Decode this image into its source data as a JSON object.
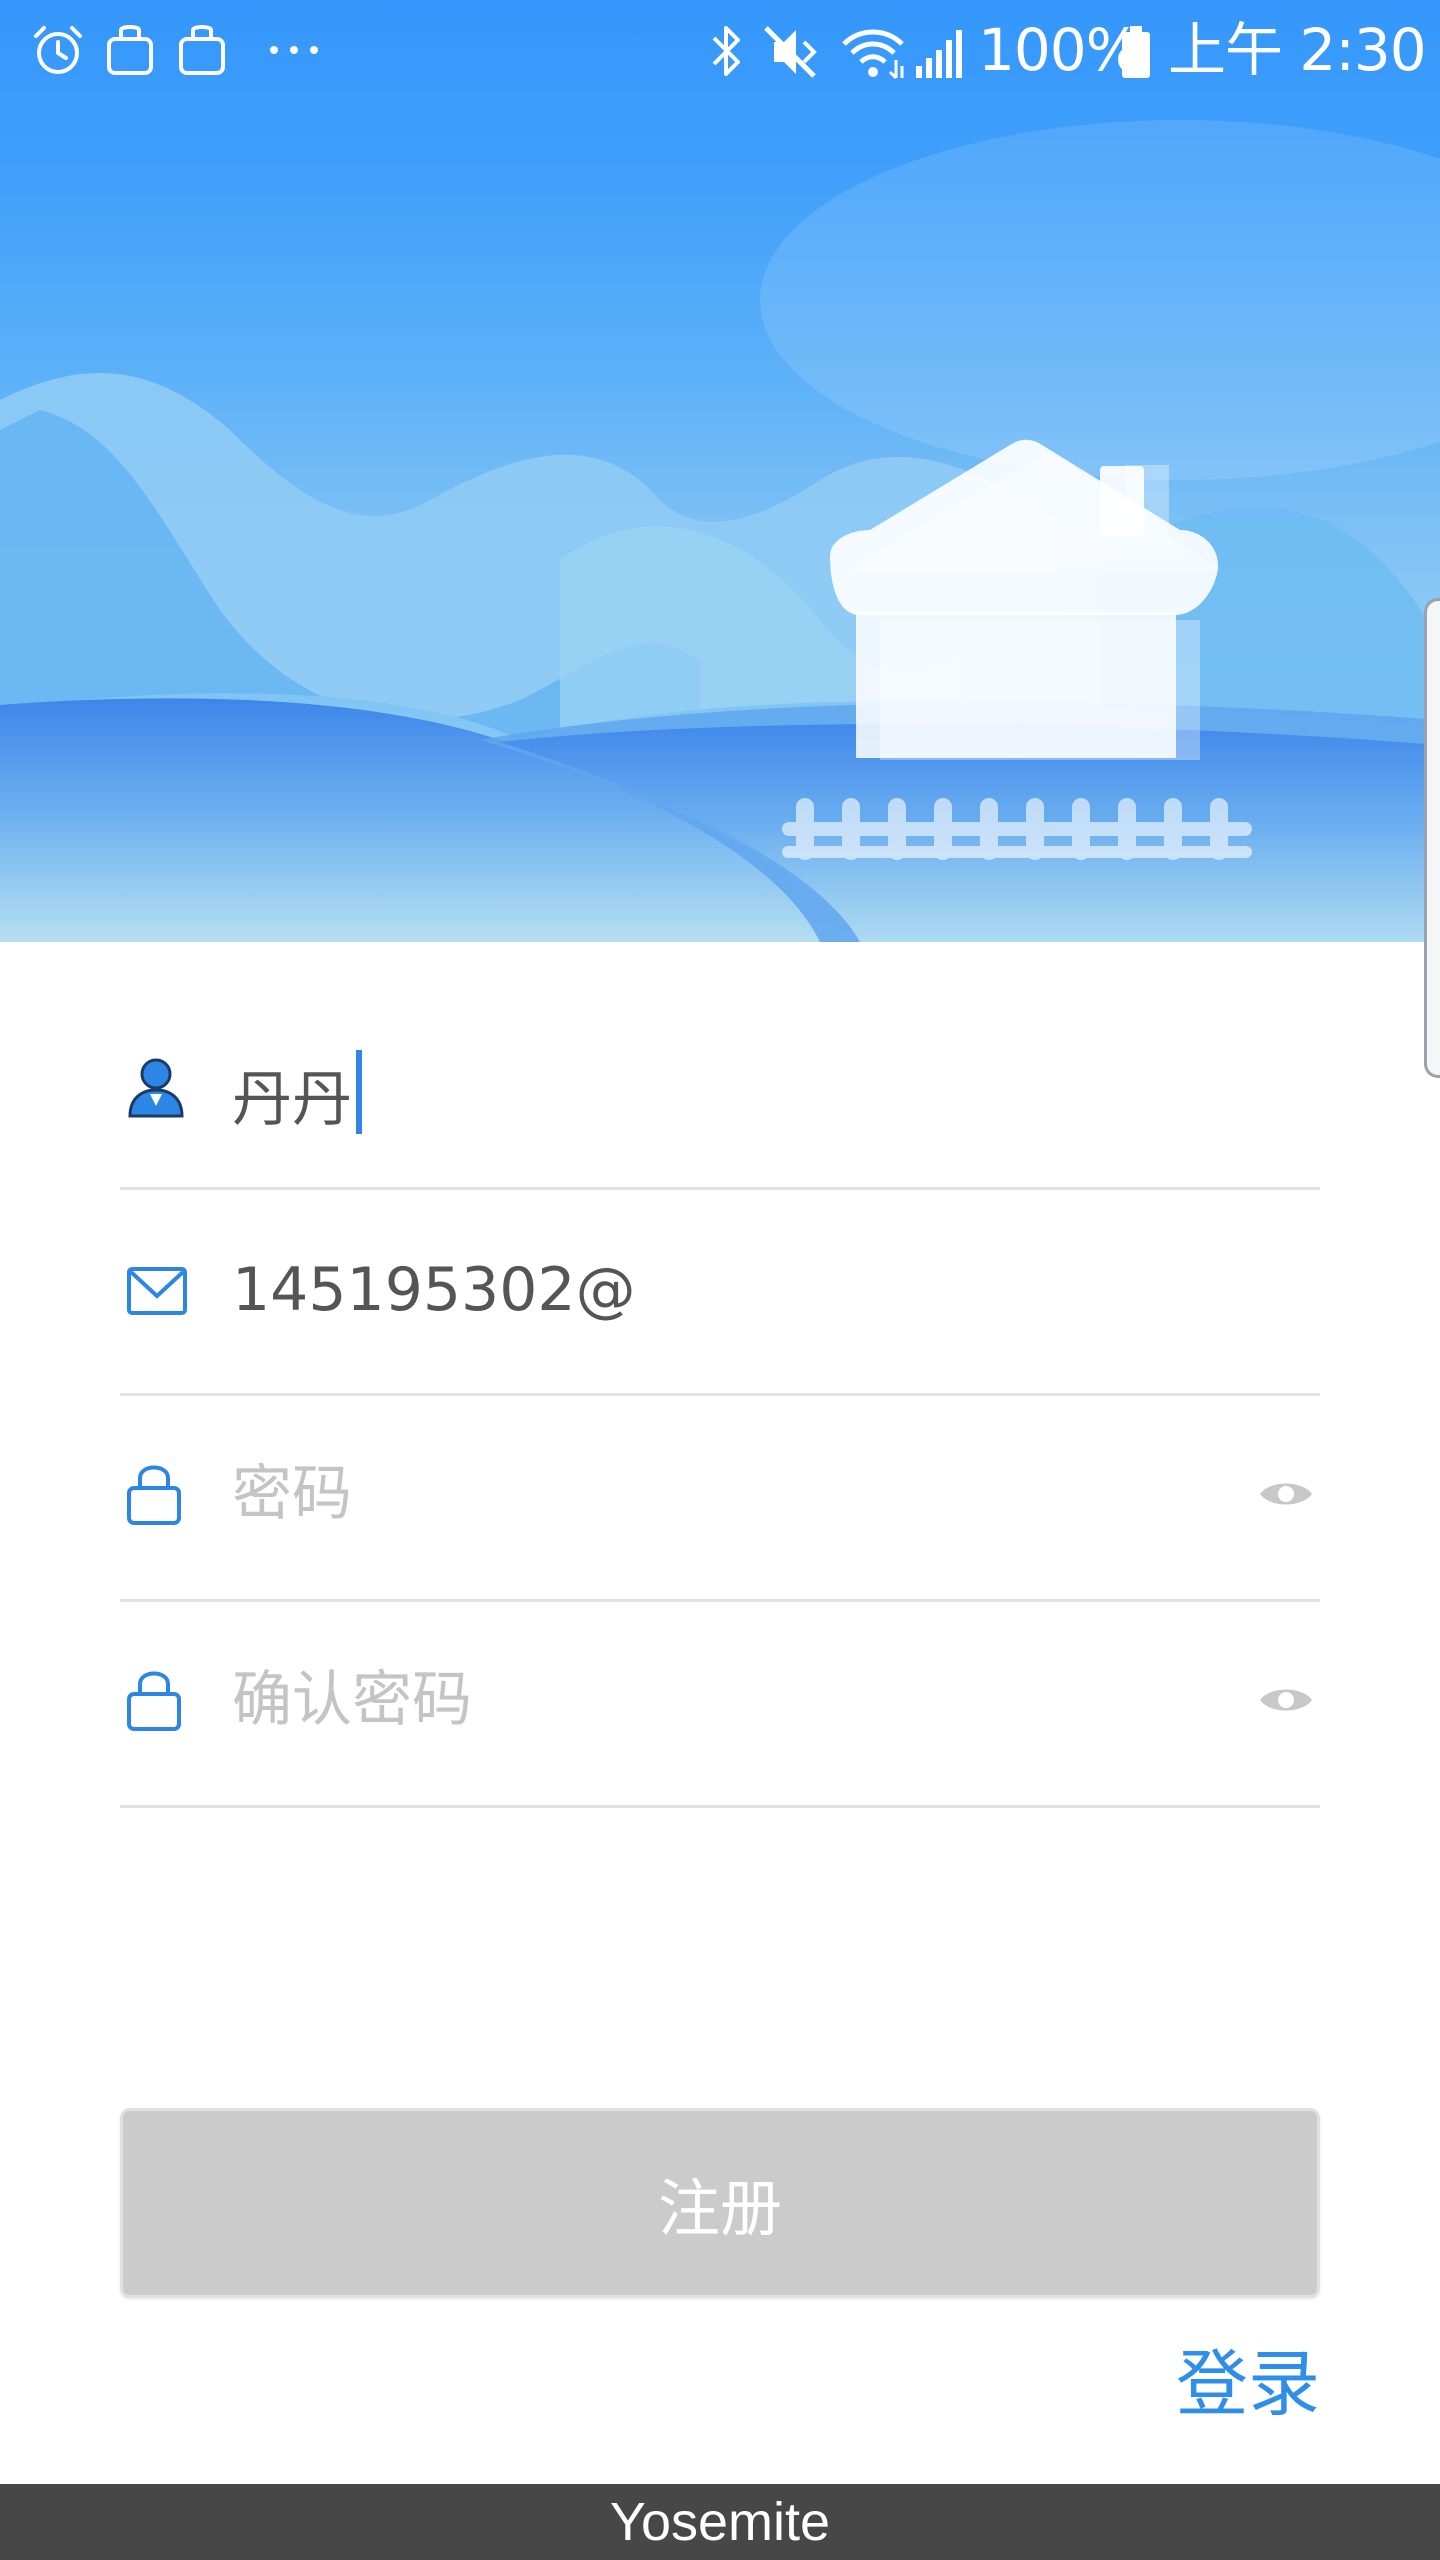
{
  "status_bar": {
    "battery_level": "100%",
    "time": "上午 2:30",
    "left_icons": [
      "alarm-icon",
      "bag-icon",
      "bag-icon",
      "more-dots-icon"
    ],
    "right_icons": [
      "bluetooth-icon",
      "mute-vibrate-icon",
      "wifi-icon",
      "signal-icon",
      "battery-icon"
    ]
  },
  "hero": {
    "illustration": "house-on-hills-icon"
  },
  "form": {
    "username": {
      "icon": "user-icon",
      "value": "丹丹"
    },
    "email": {
      "icon": "mail-icon",
      "value": "145195302@"
    },
    "password": {
      "icon": "lock-icon",
      "placeholder": "密码",
      "toggle_icon": "eye-icon"
    },
    "confirm_password": {
      "icon": "lock-icon",
      "placeholder": "确认密码",
      "toggle_icon": "eye-icon"
    }
  },
  "actions": {
    "register_label": "注册",
    "login_label": "登录"
  },
  "footer": {
    "label": "Yosemite"
  },
  "colors": {
    "accent": "#2e8ee8",
    "hero_top": "#3597fb",
    "button_disabled": "#cbcbcb",
    "placeholder": "#c4c4c4",
    "footer_bg": "#474747"
  }
}
